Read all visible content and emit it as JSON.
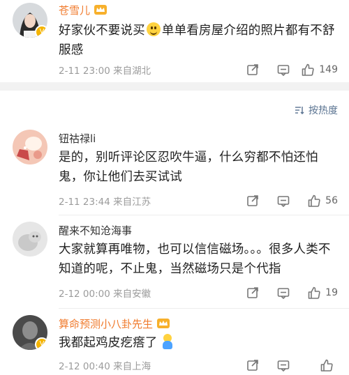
{
  "sort": {
    "label": "按热度"
  },
  "comments": [
    {
      "name": "苍雪儿",
      "text_before": "好家伙不要说买",
      "text_after": "单单看房屋介绍的照片都有不舒服感",
      "time": "2-11 23:00 来自湖北",
      "likes": "149",
      "vip": true
    },
    {
      "name": "钮祜禄li",
      "text": "是的，别听评论区忍吹牛逼，什么穷都不怕还怕鬼，你让他们去买试试",
      "time": "2-11 23:44 来自江苏",
      "likes": "56",
      "vip": false
    },
    {
      "name": "醒来不知沧海事",
      "text": "大家就算再唯物，也可以信信磁场。。。很多人类不知道的呢，不止鬼，当然磁场只是个代指",
      "time": "2-12 00:00 来自安徽",
      "likes": "19",
      "vip": false
    },
    {
      "name": "算命预测小八卦先生",
      "text": "我都起鸡皮疙瘩了",
      "time": "2-12 00:40 来自上海",
      "likes": "",
      "vip": true
    }
  ],
  "colors": {
    "vip_name": "#f07a2c",
    "meta": "#9b9b9b",
    "sort": "#5a7391",
    "divider": "#f2f2f2"
  }
}
